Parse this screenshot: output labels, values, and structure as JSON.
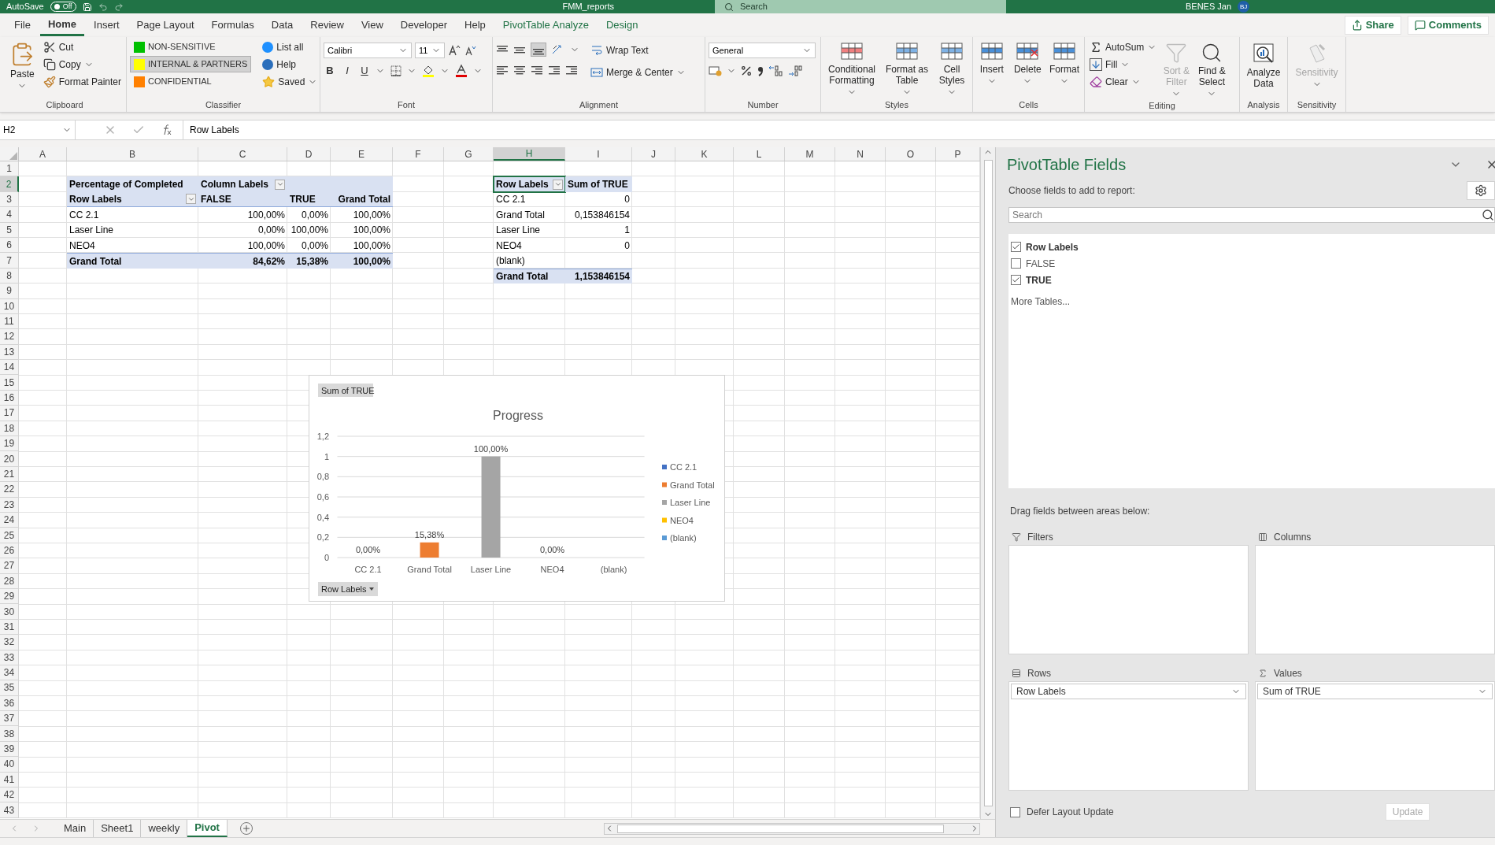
{
  "title_bar": {
    "autosave_label": "AutoSave",
    "autosave_state": "Off",
    "autosave_on": false,
    "file_name": "FMM_reports",
    "search_placeholder": "Search",
    "user_name": "BENES Jan",
    "user_initials": "BJ"
  },
  "ribbon_tabs": [
    {
      "label": "File",
      "selected": false,
      "kind": "standard"
    },
    {
      "label": "Home",
      "selected": true,
      "kind": "standard"
    },
    {
      "label": "Insert",
      "selected": false,
      "kind": "standard"
    },
    {
      "label": "Page Layout",
      "selected": false,
      "kind": "standard"
    },
    {
      "label": "Formulas",
      "selected": false,
      "kind": "standard"
    },
    {
      "label": "Data",
      "selected": false,
      "kind": "standard"
    },
    {
      "label": "Review",
      "selected": false,
      "kind": "standard"
    },
    {
      "label": "View",
      "selected": false,
      "kind": "standard"
    },
    {
      "label": "Developer",
      "selected": false,
      "kind": "standard"
    },
    {
      "label": "Help",
      "selected": false,
      "kind": "standard"
    },
    {
      "label": "PivotTable Analyze",
      "selected": false,
      "kind": "contextual"
    },
    {
      "label": "Design",
      "selected": false,
      "kind": "contextual"
    }
  ],
  "share_button": "Share",
  "comments_button": "Comments",
  "ribbon_groups": [
    {
      "kind": "clipboard",
      "label": "Clipboard",
      "items": [
        {
          "label": "Paste"
        },
        {
          "label": "Cut"
        },
        {
          "label": "Copy"
        },
        {
          "label": "Format Painter"
        }
      ]
    },
    {
      "kind": "classifier",
      "label": "Classifier",
      "labels": [
        {
          "label": "NON-SENSITIVE",
          "color": "#00c000",
          "selected": false
        },
        {
          "label": "INTERNAL & PARTNERS",
          "color": "#ffff00",
          "selected": true
        },
        {
          "label": "CONFIDENTIAL",
          "color": "#ff8000",
          "selected": false
        }
      ],
      "items": [
        {
          "label": "List all"
        },
        {
          "label": "Help"
        },
        {
          "label": "Saved"
        }
      ]
    },
    {
      "kind": "font",
      "label": "Font",
      "font_name": "Calibri",
      "font_size": "11",
      "styles": [
        "B",
        "I",
        "U"
      ]
    },
    {
      "kind": "alignment",
      "label": "Alignment",
      "items": [
        {
          "label": "Wrap Text"
        },
        {
          "label": "Merge & Center"
        }
      ]
    },
    {
      "kind": "number",
      "label": "Number",
      "format": "General"
    },
    {
      "kind": "styles",
      "label": "Styles",
      "items": [
        {
          "label": "Conditional Formatting"
        },
        {
          "label": "Format as Table"
        },
        {
          "label": "Cell Styles"
        }
      ]
    },
    {
      "kind": "cells",
      "label": "Cells",
      "items": [
        {
          "label": "Insert"
        },
        {
          "label": "Delete"
        },
        {
          "label": "Format"
        }
      ]
    },
    {
      "kind": "editing",
      "label": "Editing",
      "items": [
        {
          "label": "AutoSum",
          "disabled": false
        },
        {
          "label": "Fill",
          "disabled": false
        },
        {
          "label": "Clear",
          "disabled": false
        },
        {
          "label": "Sort & Filter",
          "disabled": true
        },
        {
          "label": "Find & Select",
          "disabled": false
        }
      ]
    },
    {
      "kind": "analysis",
      "label": "Analysis",
      "items": [
        {
          "label": "Analyze Data",
          "disabled": false
        }
      ]
    },
    {
      "kind": "sensitivity",
      "label": "Sensitivity",
      "items": [
        {
          "label": "Sensitivity",
          "disabled": true
        }
      ]
    }
  ],
  "formula_bar": {
    "name_box": "H2",
    "formula": "Row Labels"
  },
  "sheet": {
    "columns": [
      {
        "label": "A",
        "selected": false
      },
      {
        "label": "B",
        "selected": false
      },
      {
        "label": "C",
        "selected": false
      },
      {
        "label": "D",
        "selected": false
      },
      {
        "label": "E",
        "selected": false
      },
      {
        "label": "F",
        "selected": false
      },
      {
        "label": "G",
        "selected": false
      },
      {
        "label": "H",
        "selected": true
      },
      {
        "label": "I",
        "selected": false
      },
      {
        "label": "J",
        "selected": false
      },
      {
        "label": "K",
        "selected": false
      },
      {
        "label": "L",
        "selected": false
      },
      {
        "label": "M",
        "selected": false
      },
      {
        "label": "N",
        "selected": false
      },
      {
        "label": "O",
        "selected": false
      },
      {
        "label": "P",
        "selected": false
      }
    ],
    "rows": [
      {
        "label": "1",
        "selected": false
      },
      {
        "label": "2",
        "selected": true
      },
      {
        "label": "3",
        "selected": false
      },
      {
        "label": "4",
        "selected": false
      },
      {
        "label": "5",
        "selected": false
      },
      {
        "label": "6",
        "selected": false
      },
      {
        "label": "7",
        "selected": false
      },
      {
        "label": "8",
        "selected": false
      },
      {
        "label": "9",
        "selected": false
      },
      {
        "label": "10",
        "selected": false
      },
      {
        "label": "11",
        "selected": false
      },
      {
        "label": "12",
        "selected": false
      },
      {
        "label": "13",
        "selected": false
      },
      {
        "label": "14",
        "selected": false
      },
      {
        "label": "15",
        "selected": false
      },
      {
        "label": "16",
        "selected": false
      },
      {
        "label": "17",
        "selected": false
      },
      {
        "label": "18",
        "selected": false
      },
      {
        "label": "19",
        "selected": false
      },
      {
        "label": "20",
        "selected": false
      },
      {
        "label": "21",
        "selected": false
      },
      {
        "label": "22",
        "selected": false
      },
      {
        "label": "23",
        "selected": false
      },
      {
        "label": "24",
        "selected": false
      },
      {
        "label": "25",
        "selected": false
      },
      {
        "label": "26",
        "selected": false
      },
      {
        "label": "27",
        "selected": false
      },
      {
        "label": "28",
        "selected": false
      },
      {
        "label": "29",
        "selected": false
      },
      {
        "label": "30",
        "selected": false
      },
      {
        "label": "31",
        "selected": false
      },
      {
        "label": "32",
        "selected": false
      },
      {
        "label": "33",
        "selected": false
      },
      {
        "label": "34",
        "selected": false
      },
      {
        "label": "35",
        "selected": false
      },
      {
        "label": "36",
        "selected": false
      },
      {
        "label": "37",
        "selected": false
      },
      {
        "label": "38",
        "selected": false
      },
      {
        "label": "39",
        "selected": false
      },
      {
        "label": "40",
        "selected": false
      },
      {
        "label": "41",
        "selected": false
      },
      {
        "label": "42",
        "selected": false
      },
      {
        "label": "43",
        "selected": false
      }
    ],
    "pivot_tables": [
      {
        "kind": "crosstab",
        "value_field": "Percentage of Completed",
        "column_field": "Column Labels",
        "row_field": "Row Labels",
        "columns": [
          "FALSE",
          "TRUE",
          "Grand Total"
        ],
        "rows": [
          {
            "label": "CC 2.1",
            "values": [
              "100,00%",
              "0,00%",
              "100,00%"
            ]
          },
          {
            "label": "Laser Line",
            "values": [
              "0,00%",
              "100,00%",
              "100,00%"
            ]
          },
          {
            "label": "NEO4",
            "values": [
              "100,00%",
              "0,00%",
              "100,00%"
            ]
          }
        ],
        "total": {
          "label": "Grand Total",
          "values": [
            "84,62%",
            "15,38%",
            "100,00%"
          ]
        }
      },
      {
        "kind": "list",
        "row_field": "Row Labels",
        "value_field": "Sum of TRUE",
        "rows": [
          {
            "label": "CC 2.1",
            "value": "0"
          },
          {
            "label": "Grand Total",
            "value": "0,153846154"
          },
          {
            "label": "Laser Line",
            "value": "1"
          },
          {
            "label": "NEO4",
            "value": "0"
          },
          {
            "label": "(blank)"
          }
        ],
        "total": {
          "label": "Grand Total",
          "value": "1,153846154"
        }
      }
    ],
    "chart": {
      "value_button": "Sum of TRUE",
      "axis_button": "Row Labels",
      "chart_data": {
        "type": "bar",
        "title": "Progress",
        "grid": true,
        "legend": true,
        "categories": [
          "CC 2.1",
          "Grand Total",
          "Laser Line",
          "NEO4",
          "(blank)"
        ],
        "series": [
          {
            "name": "CC 2.1",
            "color": "#4472c4",
            "values": [
              0,
              null,
              null,
              null,
              null
            ]
          },
          {
            "name": "Grand Total",
            "color": "#ed7d31",
            "values": [
              null,
              0.15,
              null,
              null,
              null
            ]
          },
          {
            "name": "Laser Line",
            "color": "#a5a5a5",
            "values": [
              null,
              null,
              1,
              null,
              null
            ]
          },
          {
            "name": "NEO4",
            "color": "#ffc000",
            "values": [
              null,
              null,
              null,
              0,
              null
            ]
          },
          {
            "name": "(blank)",
            "color": "#5b9bd5",
            "values": [
              null,
              null,
              null,
              null,
              null
            ]
          }
        ],
        "ylim": [
          0,
          1.2
        ],
        "yticks": [
          {
            "value": 0,
            "label": "0"
          },
          {
            "value": 0.2,
            "label": "0,2"
          },
          {
            "value": 0.4,
            "label": "0,4"
          },
          {
            "value": 0.6,
            "label": "0,6"
          },
          {
            "value": 0.8,
            "label": "0,8"
          },
          {
            "value": 1,
            "label": "1"
          },
          {
            "value": 1.2,
            "label": "1,2"
          }
        ],
        "value_labels": [
          "0,00%",
          "15,38%",
          "100,00%",
          "0,00%",
          null
        ]
      }
    },
    "sheet_tabs": [
      {
        "label": "Main",
        "selected": false
      },
      {
        "label": "Sheet1",
        "selected": false
      },
      {
        "label": "weekly",
        "selected": false
      },
      {
        "label": "Pivot",
        "selected": true
      }
    ]
  },
  "pane": {
    "title": "PivotTable Fields",
    "subtitle": "Choose fields to add to report:",
    "search_placeholder": "Search",
    "fields": [
      {
        "label": "Row Labels",
        "checked": true
      },
      {
        "label": "FALSE",
        "checked": false
      },
      {
        "label": "TRUE",
        "checked": true
      }
    ],
    "more_tables": "More Tables...",
    "areas_hint": "Drag fields between areas below:",
    "areas": [
      {
        "kind": "filters",
        "label": "Filters"
      },
      {
        "kind": "columns",
        "label": "Columns"
      },
      {
        "kind": "rows",
        "label": "Rows",
        "items": [
          "Row Labels"
        ]
      },
      {
        "kind": "values",
        "label": "Values",
        "items": [
          "Sum of TRUE"
        ]
      }
    ],
    "defer": {
      "label": "Defer Layout Update",
      "checked": false
    },
    "update_button": "Update"
  }
}
